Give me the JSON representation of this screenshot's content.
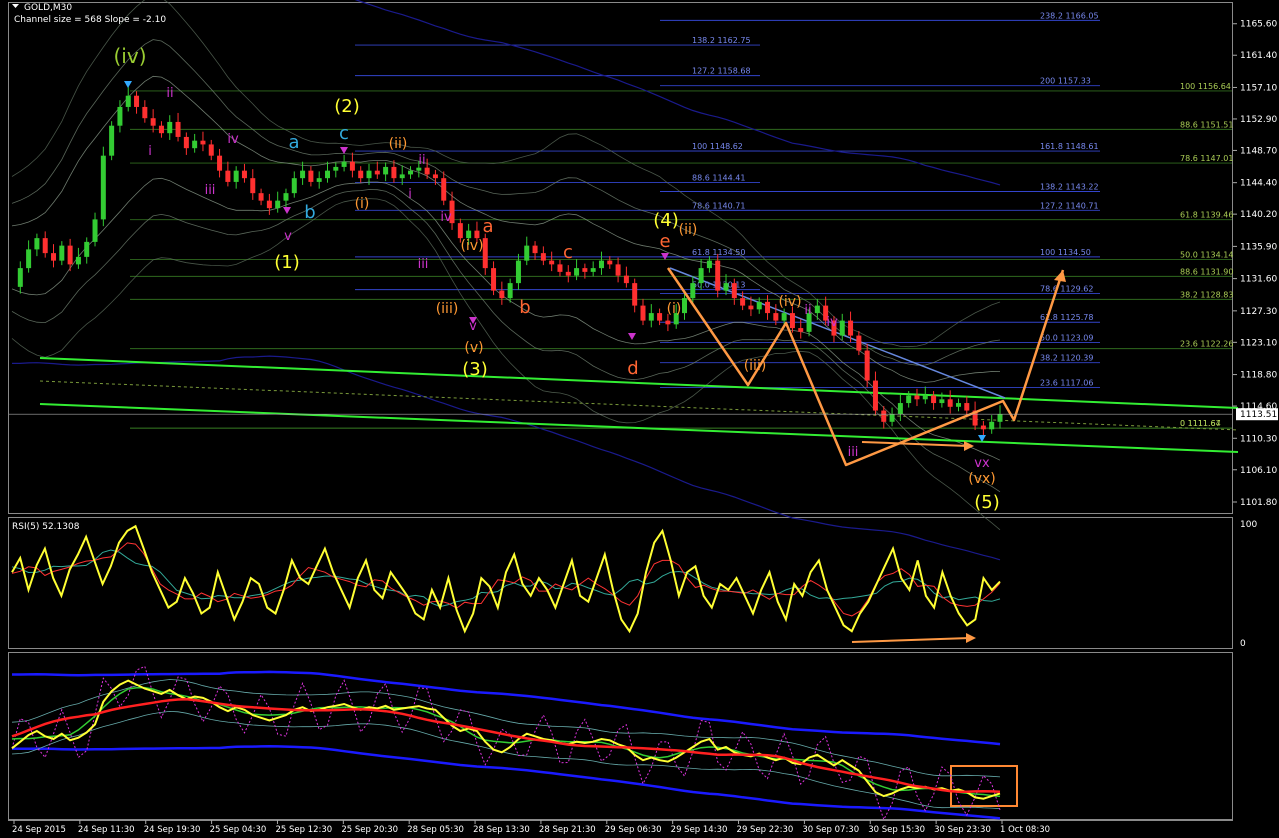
{
  "chart_data": {
    "type": "line",
    "symbol": "GOLD,M30",
    "channel_info": "Channel size = 568 Slope = -2.10",
    "current_price": "1113.51",
    "price_ylim": [
      1100.2,
      1168.5
    ],
    "price_axis_ticks": [
      "1165.60",
      "1161.40",
      "1157.10",
      "1152.90",
      "1148.70",
      "1144.40",
      "1140.20",
      "1135.90",
      "1131.60",
      "1127.30",
      "1123.10",
      "1118.80",
      "1114.60",
      "1110.30",
      "1106.10",
      "1101.80"
    ],
    "x_axis_labels": [
      "24 Sep 2015",
      "24 Sep 11:30",
      "24 Sep 19:30",
      "25 Sep 04:30",
      "25 Sep 12:30",
      "25 Sep 20:30",
      "28 Sep 05:30",
      "28 Sep 13:30",
      "28 Sep 21:30",
      "29 Sep 06:30",
      "29 Sep 14:30",
      "29 Sep 22:30",
      "30 Sep 07:30",
      "30 Sep 15:30",
      "30 Sep 23:30",
      "1 Oct 08:30"
    ],
    "price_path": [
      1130.5,
      1133,
      1135.5,
      1137,
      1135,
      1134,
      1136,
      1133.5,
      1134.5,
      1136.5,
      1139.5,
      1148,
      1152,
      1154.5,
      1156,
      1154.5,
      1153,
      1152,
      1151,
      1152.5,
      1150.5,
      1149,
      1150,
      1149.5,
      1148,
      1146,
      1144.5,
      1146,
      1145,
      1143,
      1142,
      1141,
      1142,
      1143,
      1145,
      1146,
      1144.5,
      1145,
      1146,
      1146.5,
      1147.2,
      1146,
      1145,
      1146,
      1145.5,
      1146.5,
      1145,
      1145.5,
      1146,
      1146.4,
      1145.5,
      1145,
      1142,
      1139,
      1137,
      1138,
      1137,
      1133,
      1130,
      1129,
      1131,
      1134,
      1136,
      1135,
      1134,
      1133.5,
      1132.5,
      1132,
      1133,
      1132.5,
      1133,
      1134,
      1133.5,
      1132,
      1131,
      1128,
      1126,
      1127,
      1126,
      1125.5,
      1127,
      1129,
      1131,
      1133,
      1134,
      1130,
      1131,
      1129,
      1128,
      1127.5,
      1128.5,
      1127,
      1126,
      1127,
      1125,
      1124.5,
      1127,
      1128,
      1126,
      1124,
      1126,
      1124,
      1122,
      1118,
      1114,
      1112.5,
      1113.5,
      1115,
      1116,
      1115.5,
      1116,
      1115,
      1115.5,
      1114.5,
      1115,
      1114,
      1112,
      1111.5,
      1112.5,
      1113.51
    ],
    "fib_levels": [
      {
        "label": "238.2 1166.05",
        "price": 1166.05
      },
      {
        "label": "138.2 1162.75",
        "price": 1162.75
      },
      {
        "label": "127.2 1158.68",
        "price": 1158.68
      },
      {
        "label": "200 1157.33",
        "price": 1157.33
      },
      {
        "label": "100 1156.64",
        "price": 1156.64
      },
      {
        "label": "88.6 1151.51",
        "price": 1151.51
      },
      {
        "label": "100 1148.62",
        "price": 1148.62
      },
      {
        "label": "161.8 1148.61",
        "price": 1148.61
      },
      {
        "label": "78.6 1147.01",
        "price": 1147.01
      },
      {
        "label": "88.6 1144.41",
        "price": 1144.41
      },
      {
        "label": "138.2 1143.22",
        "price": 1143.22
      },
      {
        "label": "78.6 1140.71",
        "price": 1140.71
      },
      {
        "label": "127.2 1140.71",
        "price": 1140.71
      },
      {
        "label": "61.8 1139.46",
        "price": 1139.46
      },
      {
        "label": "61.8 1134.50",
        "price": 1134.5
      },
      {
        "label": "100 1134.50",
        "price": 1134.5
      },
      {
        "label": "50.0 1134.14",
        "price": 1134.14
      },
      {
        "label": "88.6 1131.90",
        "price": 1131.9
      },
      {
        "label": "50.0 1130.13",
        "price": 1130.13
      },
      {
        "label": "78.6 1129.62",
        "price": 1129.62
      },
      {
        "label": "38.2 1128.83",
        "price": 1128.83
      },
      {
        "label": "61.8 1125.78",
        "price": 1125.78
      },
      {
        "label": "50.0 1123.09",
        "price": 1123.09
      },
      {
        "label": "23.6 1122.26",
        "price": 1122.26
      },
      {
        "label": "38.2 1120.39",
        "price": 1120.39
      },
      {
        "label": "23.6 1117.06",
        "price": 1117.06
      },
      {
        "label": "0 1111.67",
        "price": 1111.67
      },
      {
        "label": "0 1111.64",
        "price": 1111.64
      }
    ],
    "wave_labels": [
      {
        "text": "(iv)",
        "color": "#9acd32"
      },
      {
        "text": "ii",
        "color": "#cc33cc"
      },
      {
        "text": "i",
        "color": "#cc33cc"
      },
      {
        "text": "iii",
        "color": "#cc33cc"
      },
      {
        "text": "iv",
        "color": "#cc33cc"
      },
      {
        "text": "v",
        "color": "#cc33cc"
      },
      {
        "text": "(1)",
        "color": "#ffff33"
      },
      {
        "text": "a",
        "color": "#33aadd"
      },
      {
        "text": "b",
        "color": "#33aadd"
      },
      {
        "text": "c",
        "color": "#33aadd"
      },
      {
        "text": "(2)",
        "color": "#ffff33"
      },
      {
        "text": "(ii)",
        "color": "#ff9933"
      },
      {
        "text": "(i)",
        "color": "#ff9933"
      },
      {
        "text": "ii",
        "color": "#cc33cc"
      },
      {
        "text": "i",
        "color": "#cc33cc"
      },
      {
        "text": "iii",
        "color": "#cc33cc"
      },
      {
        "text": "iv",
        "color": "#cc33cc"
      },
      {
        "text": "(iv)",
        "color": "#ff9933"
      },
      {
        "text": "(iii)",
        "color": "#ff9933"
      },
      {
        "text": "v",
        "color": "#cc33cc"
      },
      {
        "text": "(v)",
        "color": "#ff9933"
      },
      {
        "text": "(3)",
        "color": "#ffff33"
      },
      {
        "text": "a",
        "color": "#ff6633"
      },
      {
        "text": "b",
        "color": "#ff6633"
      },
      {
        "text": "c",
        "color": "#ff6633"
      },
      {
        "text": "d",
        "color": "#ff6633"
      },
      {
        "text": "(4)",
        "color": "#ffff33"
      },
      {
        "text": "e",
        "color": "#ff6633"
      },
      {
        "text": "(ii)",
        "color": "#ff9933"
      },
      {
        "text": "(i)",
        "color": "#ff9933"
      },
      {
        "text": "(iii)",
        "color": "#ff9933"
      },
      {
        "text": "(iv)",
        "color": "#ff9933"
      },
      {
        "text": "ii",
        "color": "#cc33cc"
      },
      {
        "text": "iv",
        "color": "#cc33cc"
      },
      {
        "text": "iii",
        "color": "#cc33cc"
      },
      {
        "text": "vx",
        "color": "#cc33cc"
      },
      {
        "text": "(vx)",
        "color": "#ff9933"
      },
      {
        "text": "(5)",
        "color": "#ffff33"
      }
    ],
    "rsi": {
      "label": "RSI(5) 52.1308",
      "ylim": [
        0,
        100
      ],
      "axis_labels": [
        "100",
        "0"
      ],
      "values": [
        60,
        72,
        45,
        66,
        80,
        55,
        40,
        62,
        75,
        90,
        70,
        50,
        65,
        85,
        95,
        99,
        80,
        60,
        45,
        30,
        35,
        55,
        42,
        25,
        30,
        60,
        40,
        20,
        35,
        55,
        50,
        30,
        25,
        45,
        70,
        55,
        50,
        65,
        80,
        60,
        45,
        30,
        55,
        70,
        45,
        38,
        60,
        50,
        40,
        25,
        20,
        45,
        30,
        55,
        28,
        10,
        25,
        55,
        48,
        30,
        60,
        75,
        50,
        40,
        55,
        45,
        30,
        50,
        70,
        40,
        35,
        55,
        75,
        45,
        20,
        10,
        25,
        60,
        85,
        95,
        70,
        40,
        60,
        65,
        40,
        30,
        50,
        45,
        55,
        40,
        25,
        45,
        60,
        35,
        20,
        50,
        40,
        60,
        70,
        45,
        30,
        15,
        10,
        25,
        35,
        50,
        65,
        80,
        55,
        45,
        70,
        40,
        30,
        60,
        40,
        25,
        15,
        20,
        55,
        45,
        52
      ]
    },
    "oscillator_bands": {
      "series": [
        {
          "name": "red_ma",
          "color": "#ff2020"
        },
        {
          "name": "yellow",
          "color": "#ffff33"
        },
        {
          "name": "green",
          "color": "#33cc33"
        },
        {
          "name": "blue_band",
          "color": "#1a1aff"
        },
        {
          "name": "magenta_dotted",
          "color": "#dd33dd"
        }
      ]
    },
    "colors": {
      "background": "#000000",
      "bull_candle": "#33cc33",
      "bear_candle": "#ff3030",
      "channel": "#33ee33",
      "fib_line": "#3344cc",
      "fib_text": "#7788ee",
      "fib_right": "#aacc55",
      "arrows": "#ff9944",
      "highlight_box": "#ff8833"
    }
  }
}
